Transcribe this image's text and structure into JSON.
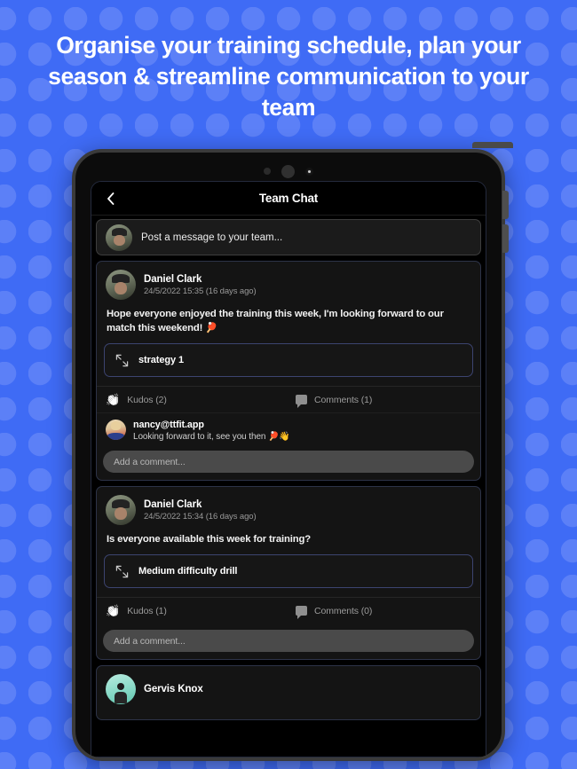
{
  "headline": "Organise your training schedule, plan your season & streamline communication to your team",
  "theme": {
    "background": "#3f6bf5",
    "dot": "#5c80f7",
    "screen_bg": "#000000",
    "card_border": "#2d3348",
    "accent_border": "#3c4470"
  },
  "device": {
    "sensor_icons": [
      "sensor-dot-small",
      "camera-lens",
      "proximity-sensor"
    ]
  },
  "app": {
    "nav": {
      "back_icon": "chevron-left-icon",
      "title": "Team Chat"
    },
    "composer": {
      "avatar": "user-avatar",
      "placeholder": "Post a message to your team..."
    },
    "posts": [
      {
        "author": "Daniel Clark",
        "avatar": "daniel",
        "timestamp": "24/5/2022 15:35 (16 days ago)",
        "body": "Hope everyone enjoyed the training this week, I'm looking forward to our match this weekend! 🏓",
        "attachment": {
          "icon": "expand-arrows-icon",
          "label": "strategy 1"
        },
        "kudos": {
          "icon": "clapping-hands-icon",
          "label": "Kudos (2)"
        },
        "comments_action": {
          "icon": "speech-bubble-icon",
          "label": "Comments (1)"
        },
        "comments": [
          {
            "author": "nancy@ttfit.app",
            "avatar": "nancy",
            "text": "Looking forward to it, see you then 🏓👋"
          }
        ],
        "add_comment_placeholder": "Add a comment..."
      },
      {
        "author": "Daniel Clark",
        "avatar": "daniel",
        "timestamp": "24/5/2022 15:34 (16 days ago)",
        "body": "Is everyone available this week for training?",
        "attachment": {
          "icon": "expand-arrows-icon",
          "label": "Medium difficulty drill"
        },
        "kudos": {
          "icon": "clapping-hands-icon",
          "label": "Kudos (1)"
        },
        "comments_action": {
          "icon": "speech-bubble-icon",
          "label": "Comments (0)"
        },
        "comments": [],
        "add_comment_placeholder": "Add a comment..."
      },
      {
        "author": "Gervis Knox",
        "avatar": "gervis",
        "timestamp": "",
        "body": "",
        "attachment": null,
        "kudos": null,
        "comments_action": null,
        "comments": [],
        "add_comment_placeholder": ""
      }
    ]
  }
}
